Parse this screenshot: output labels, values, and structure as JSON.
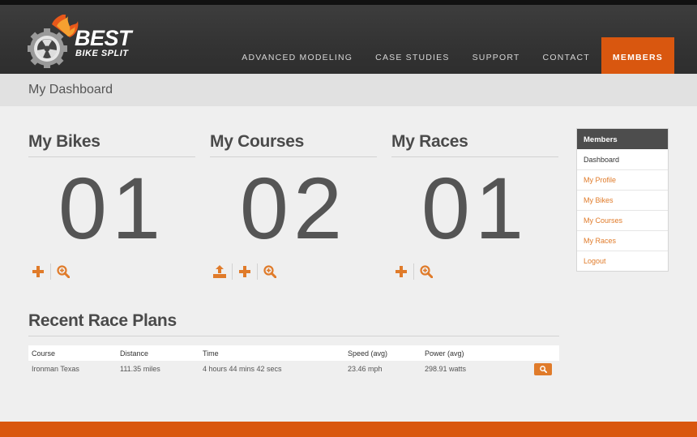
{
  "brand": {
    "line1": "BEST",
    "line2": "BIKE SPLIT"
  },
  "nav": [
    "ADVANCED MODELING",
    "CASE STUDIES",
    "SUPPORT",
    "CONTACT",
    "MEMBERS"
  ],
  "page_title": "My Dashboard",
  "stats": [
    {
      "title": "My Bikes",
      "count": "01"
    },
    {
      "title": "My Courses",
      "count": "02"
    },
    {
      "title": "My Races",
      "count": "01"
    }
  ],
  "sidebar": {
    "header": "Members",
    "items": [
      "Dashboard",
      "My Profile",
      "My Bikes",
      "My Courses",
      "My Races",
      "Logout"
    ]
  },
  "plans": {
    "title": "Recent Race Plans",
    "columns": [
      "Course",
      "Distance",
      "Time",
      "Speed (avg)",
      "Power (avg)"
    ],
    "rows": [
      [
        "Ironman Texas",
        "111.35 miles",
        "4 hours 44 mins 42 secs",
        "23.46 mph",
        "298.91 watts"
      ]
    ]
  },
  "icons": {
    "add": "plus-icon",
    "search": "zoom-in-icon",
    "upload": "upload-icon",
    "view": "magnifier-icon"
  },
  "colors": {
    "accent": "#d9570f",
    "link": "#e07b2a",
    "header": "#333333"
  }
}
